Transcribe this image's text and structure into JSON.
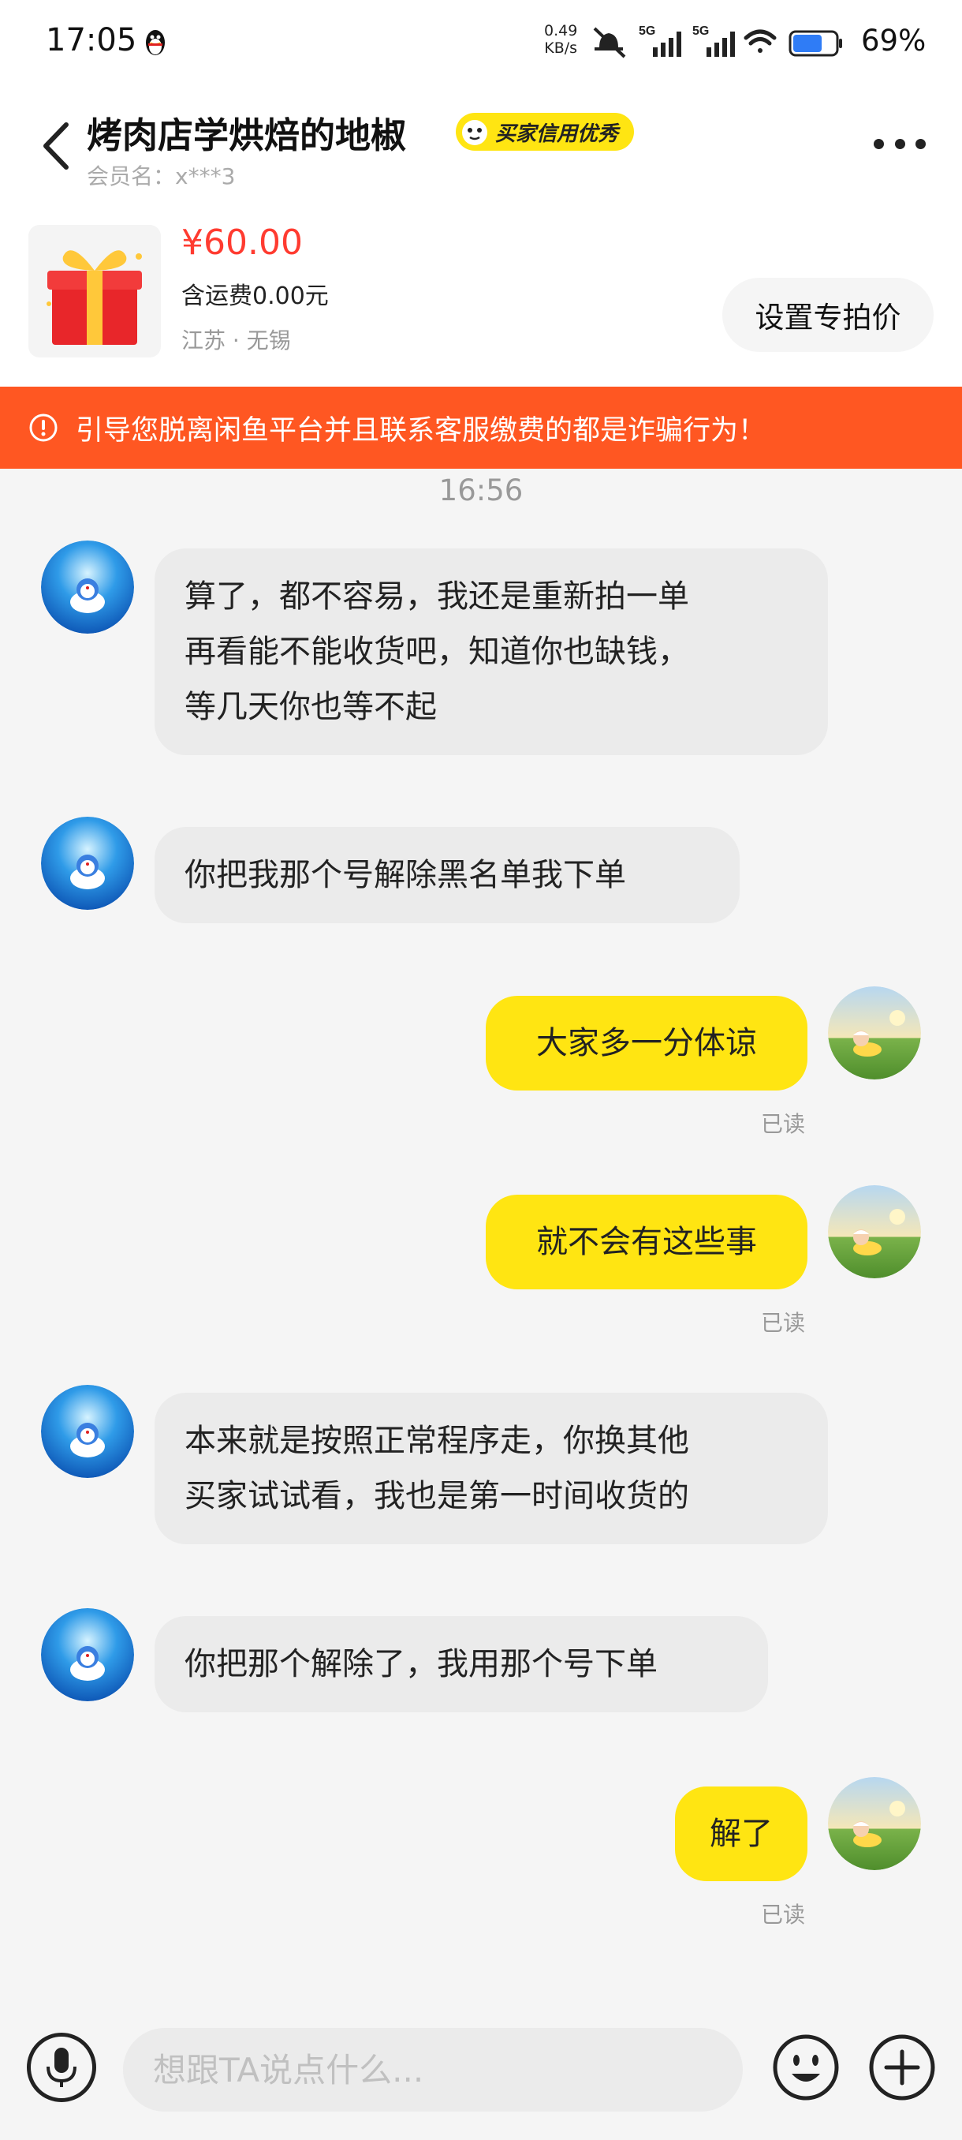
{
  "status_bar": {
    "time": "17:05",
    "net_speed_value": "0.49",
    "net_speed_unit": "KB/s",
    "signal_1": "5G",
    "signal_2": "5G",
    "battery": "69%",
    "battery_level": 0.69
  },
  "header": {
    "title": "烤肉店学烘焙的地椒",
    "badge": "买家信用优秀",
    "member": "会员名：x***3"
  },
  "product": {
    "price": "¥60.00",
    "shipping": "含运费0.00元",
    "location": "江苏 · 无锡",
    "special_price_button": "设置专拍价"
  },
  "warning": {
    "text": "引导您脱离闲鱼平台并且联系客服缴费的都是诈骗行为！"
  },
  "timestamp": "16:56",
  "messages": [
    {
      "side": "in",
      "lines": [
        "算了，都不容易，我还是重新拍一单",
        "再看能不能收货吧，知道你也缺钱，",
        "等几天你也等不起"
      ]
    },
    {
      "side": "in",
      "lines": [
        "你把我那个号解除黑名单我下单"
      ]
    },
    {
      "side": "out",
      "text": "大家多一分体谅",
      "read": "已读"
    },
    {
      "side": "out",
      "text": "就不会有这些事",
      "read": "已读"
    },
    {
      "side": "in",
      "lines": [
        "本来就是按照正常程序走，你换其他",
        "买家试试看，我也是第一时间收货的"
      ]
    },
    {
      "side": "in",
      "lines": [
        "你把那个解除了，我用那个号下单"
      ]
    },
    {
      "side": "out",
      "text": "解了",
      "read": "已读"
    }
  ],
  "input": {
    "placeholder": "想跟TA说点什么..."
  },
  "colors": {
    "accent_yellow": "#ffe512",
    "warning_orange": "#ff5722",
    "price_red": "#ff3b30",
    "incoming_bubble": "#ebebeb",
    "page_bg": "#f5f5f5"
  },
  "icons": [
    "qq-penguin-icon",
    "mute-icon",
    "signal-icon",
    "wifi-icon",
    "battery-icon",
    "back-arrow-icon",
    "credit-badge-icon",
    "more-icon",
    "gift-box-icon",
    "warning-icon",
    "mic-icon",
    "emoji-icon",
    "plus-icon"
  ]
}
